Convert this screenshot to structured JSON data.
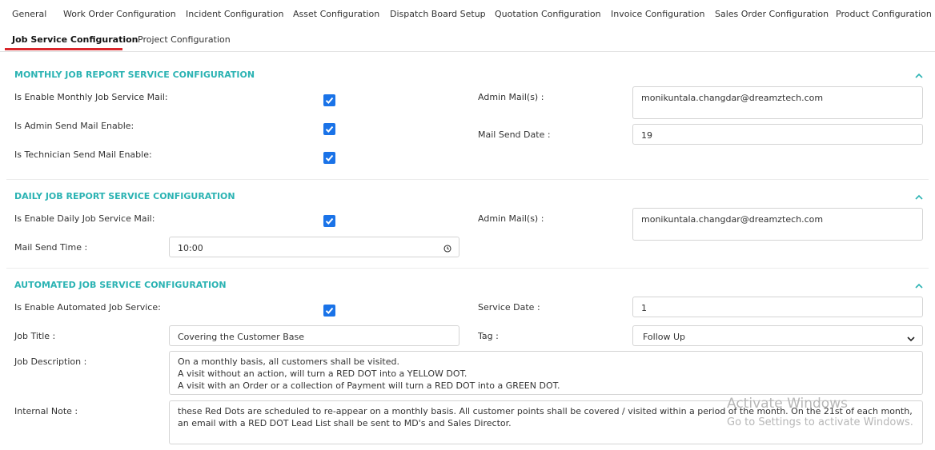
{
  "tabs": {
    "row1": [
      "General",
      "Work Order Configuration",
      "Incident Configuration",
      "Asset Configuration",
      "Dispatch Board Setup",
      "Quotation Configuration",
      "Invoice Configuration",
      "Sales Order Configuration",
      "Product Configuration"
    ],
    "row2": [
      "Job Service Configuration",
      "Project Configuration"
    ],
    "active": "Job Service Configuration"
  },
  "monthly": {
    "title": "MONTHLY JOB REPORT SERVICE CONFIGURATION",
    "enable_label": "Is Enable Monthly Job Service Mail:",
    "admin_send_label": "Is Admin Send Mail Enable:",
    "tech_send_label": "Is Technician Send Mail Enable:",
    "admin_mails_label": "Admin Mail(s) :",
    "admin_mails_value": "monikuntala.changdar@dreamztech.com",
    "send_date_label": "Mail Send Date :",
    "send_date_value": "19"
  },
  "daily": {
    "title": "DAILY JOB REPORT SERVICE CONFIGURATION",
    "enable_label": "Is Enable Daily Job Service Mail:",
    "admin_mails_label": "Admin Mail(s) :",
    "admin_mails_value": "monikuntala.changdar@dreamztech.com",
    "send_time_label": "Mail Send Time :",
    "send_time_value": "10:00"
  },
  "automated": {
    "title": "AUTOMATED JOB SERVICE CONFIGURATION",
    "enable_label": "Is Enable Automated Job Service:",
    "service_date_label": "Service Date :",
    "service_date_value": "1",
    "job_title_label": "Job Title :",
    "job_title_value": "Covering the Customer Base",
    "tag_label": "Tag :",
    "tag_value": "Follow Up",
    "job_desc_label": "Job Description :",
    "job_desc_value": "On a monthly basis, all customers shall be visited.\nA visit without an action, will turn a RED DOT into a YELLOW DOT.\nA visit with an Order or a collection of Payment will turn a RED DOT into a GREEN DOT.",
    "internal_note_label": "Internal Note :",
    "internal_note_value": "these Red Dots are scheduled to re-appear on a monthly basis. All customer points shall be covered / visited within a period of the month. On the 21st of each month, an email with a RED DOT Lead List shall be sent to MD's and Sales Director."
  },
  "watermark": {
    "line1": "Activate Windows",
    "line2": "Go to Settings to activate Windows."
  },
  "colors": {
    "accent": "#2bb3b3",
    "checkbox": "#1a73e8",
    "active_tab_underline": "#d9262b"
  }
}
